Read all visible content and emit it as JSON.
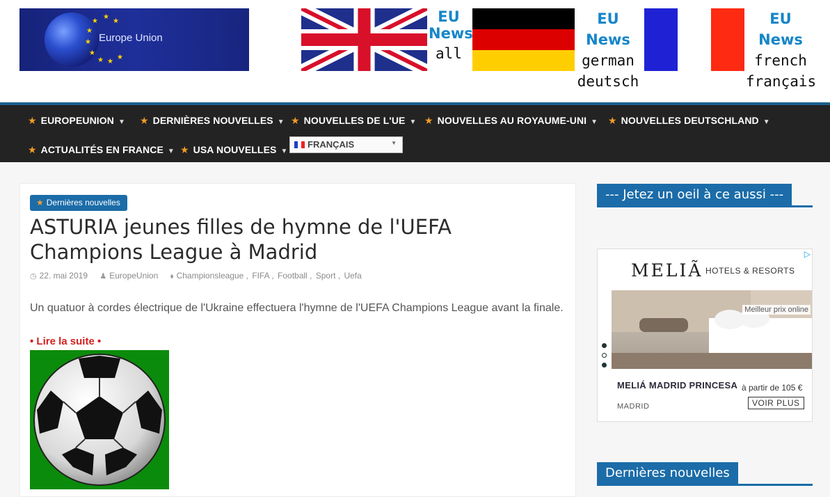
{
  "header": {
    "logo_text": "Europe Union",
    "flags": [
      {
        "eu": "EU",
        "line1": "News",
        "line2": "all"
      },
      {
        "eu": "EU News",
        "line1": "german",
        "line2": "deutsch"
      },
      {
        "eu": "EU News",
        "line1": "french",
        "line2": "français"
      }
    ]
  },
  "nav": {
    "items": [
      "EUROPEUNION",
      "DERNIÈRES NOUVELLES",
      "NOUVELLES DE L'UE",
      "NOUVELLES AU ROYAUME-UNI",
      "NOUVELLES DEUTSCHLAND",
      "ACTUALITÉS EN FRANCE",
      "USA NOUVELLES"
    ],
    "language": "FRANÇAIS"
  },
  "article": {
    "category": "Dernières nouvelles",
    "title": "ASTURIA jeunes filles de hymne de l'UEFA Champions League à Madrid",
    "date": "22. mai 2019",
    "author": "EuropeUnion",
    "tags": [
      "Championsleague",
      "FIFA",
      "Football",
      "Sport",
      "Uefa"
    ],
    "excerpt": "Un quatuor à cordes électrique de l'Ukraine effectuera l'hymne de l'UEFA Champions League avant la finale.",
    "read_more": "• Lire la suite •"
  },
  "sidebar": {
    "widget1_title": "--- Jetez un oeil à ce aussi ---",
    "widget2_title": "Dernières nouvelles",
    "ad": {
      "brand": "MELIÃ",
      "brand_sub": "HOTELS & RESORTS",
      "best_price": "Meilleur prix online",
      "hotel": "MELIÁ MADRID PRINCESA",
      "price": "à partir de 105 €",
      "city": "MADRID",
      "cta": "VOIR PLUS"
    }
  },
  "colors": {
    "nav_bg": "#232323",
    "accent_blue": "#1b6ca8",
    "star_orange": "#f39c25",
    "read_more_red": "#d31f1f"
  }
}
